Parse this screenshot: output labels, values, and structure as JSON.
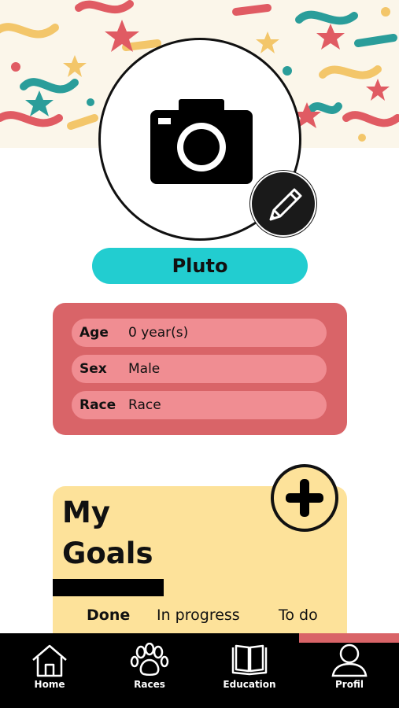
{
  "pet": {
    "name": "Pluto",
    "info": [
      {
        "label": "Age",
        "value": "0 year(s)"
      },
      {
        "label": "Sex",
        "value": "Male"
      },
      {
        "label": "Race",
        "value": "Race"
      }
    ]
  },
  "goals": {
    "title_line1": "My",
    "title_line2": "Goals",
    "tabs": [
      {
        "label": "Done",
        "active": true
      },
      {
        "label": "In progress",
        "active": false
      },
      {
        "label": "To do",
        "active": false
      }
    ]
  },
  "nav": {
    "items": [
      {
        "label": "Home",
        "icon": "home-icon"
      },
      {
        "label": "Races",
        "icon": "paw-icon"
      },
      {
        "label": "Education",
        "icon": "book-icon"
      },
      {
        "label": "Profil",
        "icon": "person-icon"
      }
    ]
  },
  "colors": {
    "accent_teal": "#22cdd0",
    "card_red": "#d96468",
    "row_pink": "#f08d92",
    "goals_yellow": "#fde29a",
    "nav_black": "#000000"
  }
}
